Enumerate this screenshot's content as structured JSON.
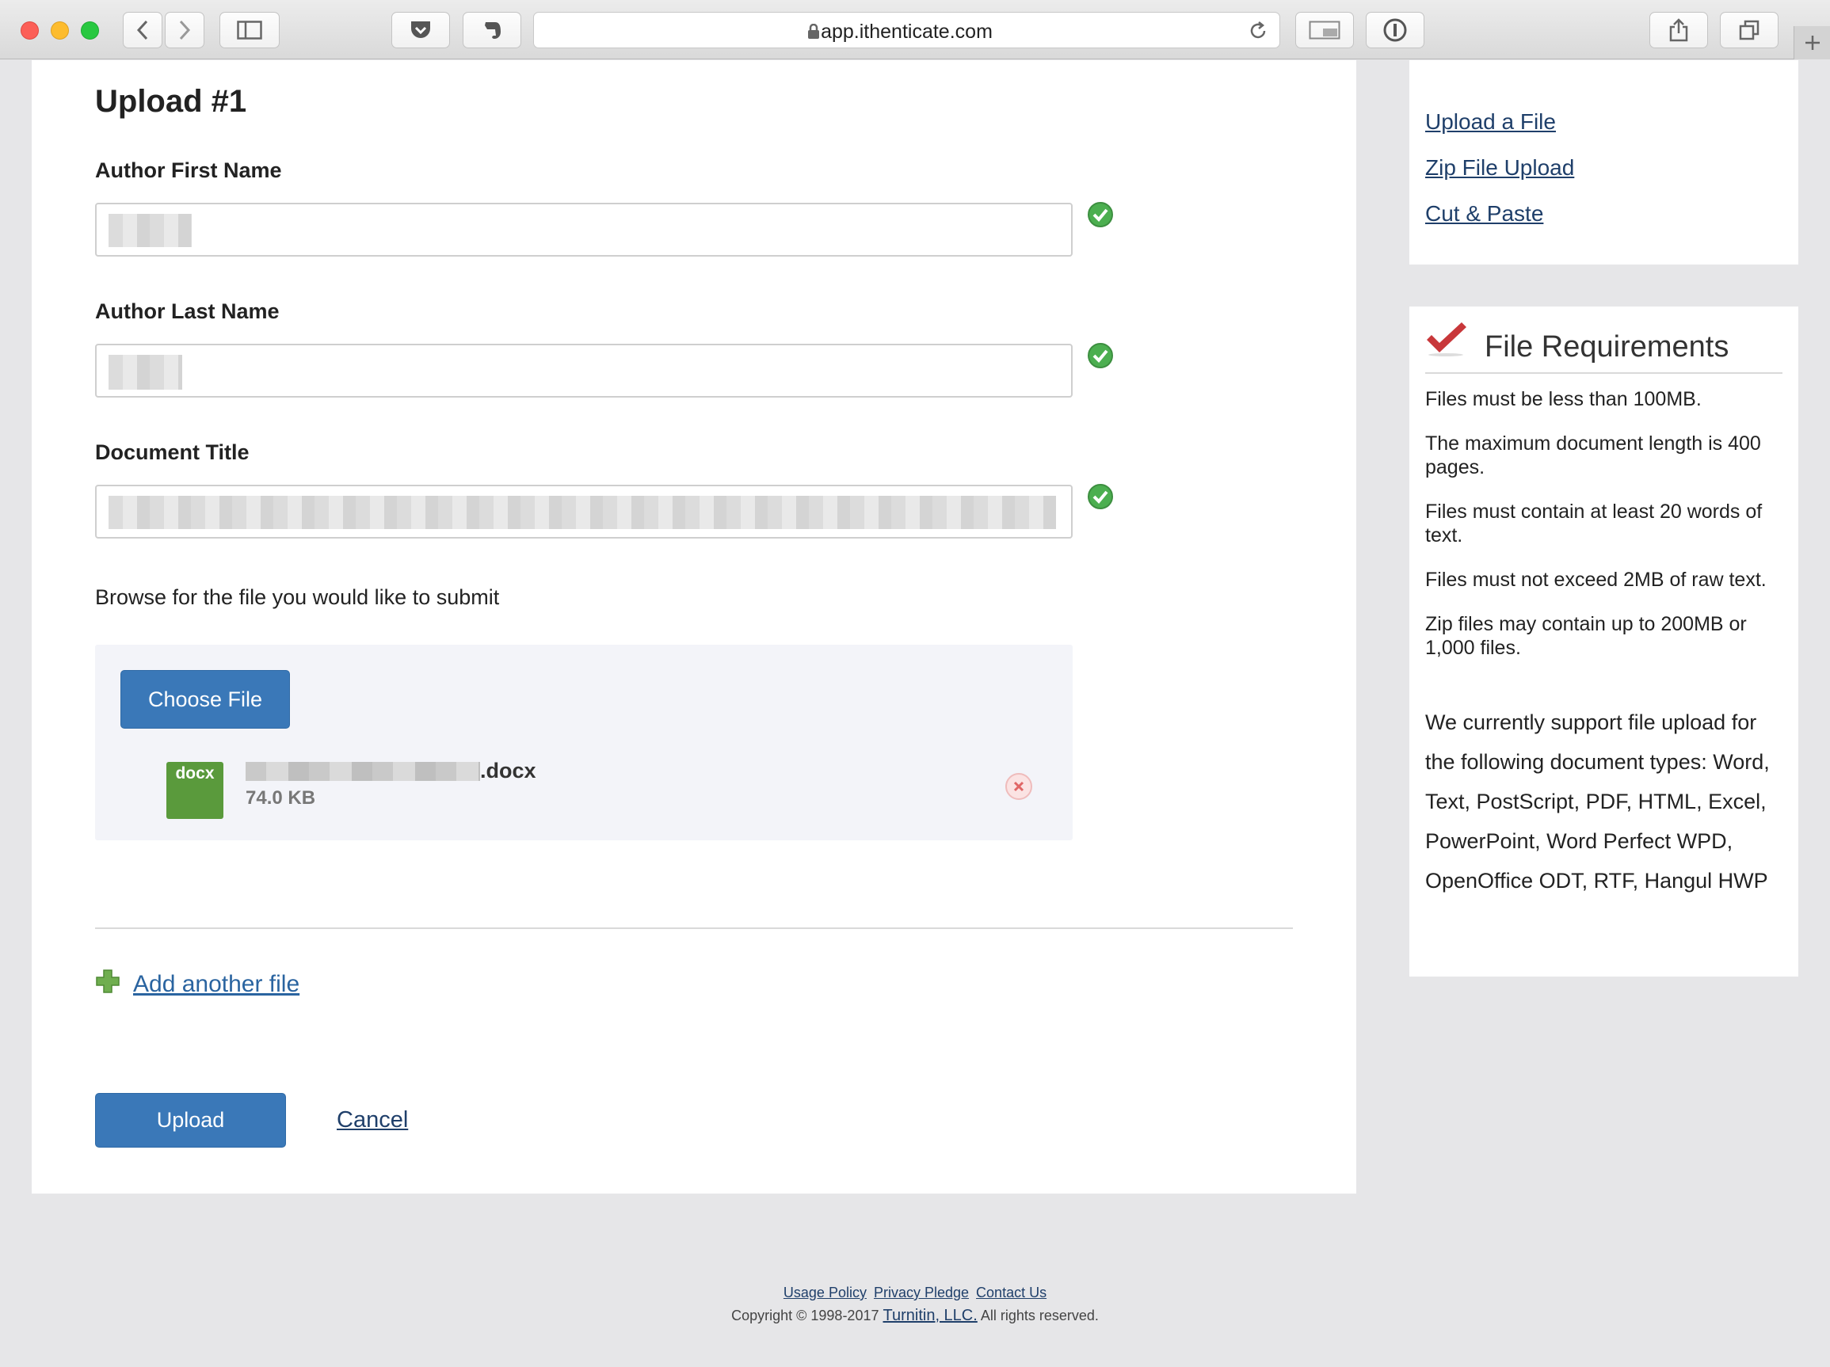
{
  "browser": {
    "url": "app.ithenticate.com"
  },
  "form": {
    "heading": "Upload #1",
    "first_name_label": "Author First Name",
    "last_name_label": "Author Last Name",
    "title_label": "Document Title",
    "browse_text": "Browse for the file you would like to submit",
    "choose_file_label": "Choose File",
    "file": {
      "type_badge": "docx",
      "extension": ".docx",
      "size": "74.0 KB"
    },
    "add_another_label": "Add another file",
    "upload_label": "Upload",
    "cancel_label": "Cancel"
  },
  "sidebar": {
    "links": [
      "Upload a File",
      "Zip File Upload",
      "Cut & Paste"
    ],
    "requirements_title": "File Requirements",
    "requirements": [
      "Files must be less than 100MB.",
      "The maximum document length is 400 pages.",
      "Files must contain at least 20 words of text.",
      "Files must not exceed 2MB of raw text.",
      "Zip files may contain up to 200MB or 1,000 files."
    ],
    "support_text": "We currently support file upload for the following document types: Word, Text, PostScript, PDF, HTML, Excel, PowerPoint, Word Perfect WPD, OpenOffice ODT, RTF, Hangul HWP"
  },
  "footer": {
    "links": [
      "Usage Policy",
      "Privacy Pledge",
      "Contact Us"
    ],
    "copyright_prefix": "Copyright © 1998-2017",
    "company": "Turnitin, LLC.",
    "rights": "All rights reserved."
  },
  "colors": {
    "primary_button": "#3a78b8",
    "valid_check": "#4caf50",
    "docx_badge": "#5a9a3c",
    "link": "#1f3f6a"
  }
}
